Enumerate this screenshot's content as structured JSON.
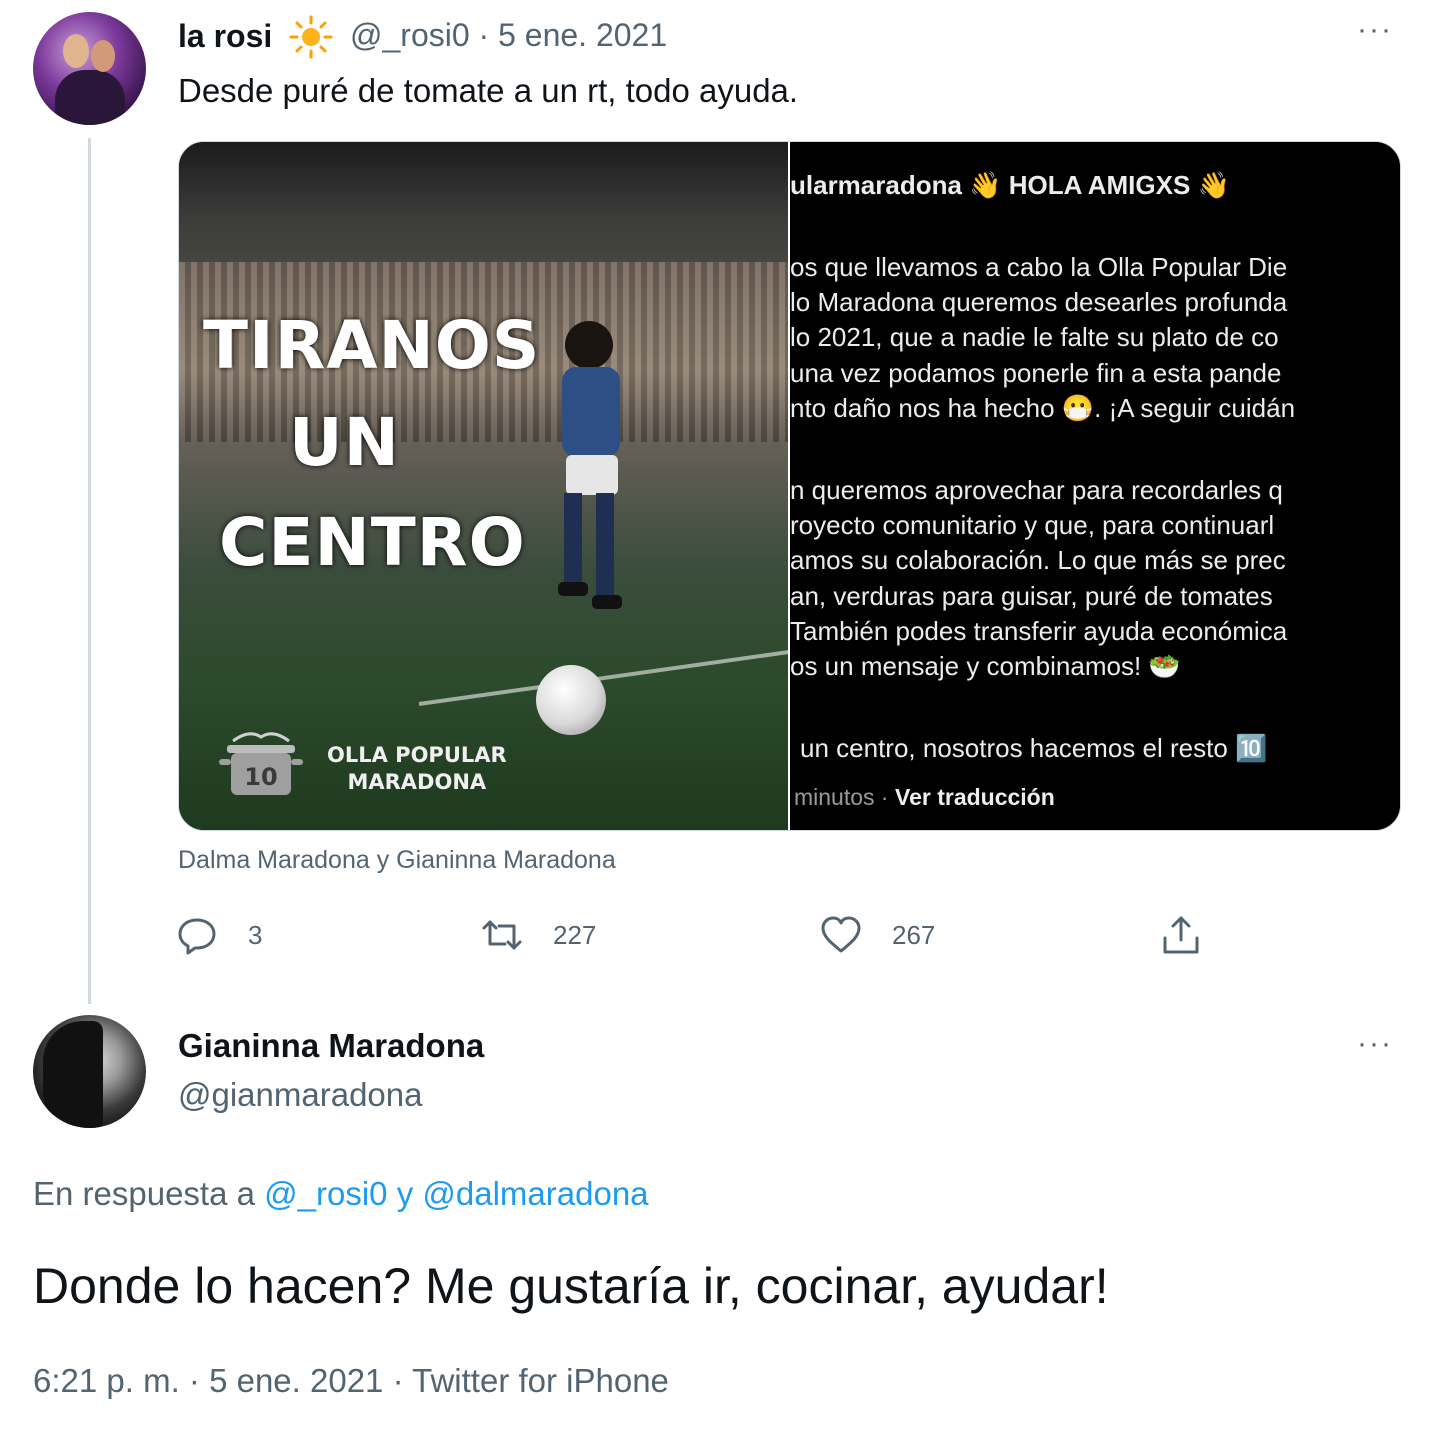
{
  "tweet1": {
    "display_name": "la rosi",
    "name_emoji": "sun-icon",
    "handle_date": "@_rosi0 · 5 ene. 2021",
    "text": "Desde puré de tomate a un rt, todo ayuda.",
    "more": "···",
    "media": {
      "left_text": [
        "TIRANOS",
        "UN",
        "CENTRO"
      ],
      "logo_text_line1": "OLLA POPULAR",
      "logo_text_line2": "MARADONA",
      "logo_number": "10",
      "right_header": "ularmaradona 👋 HOLA AMIGXS 👋",
      "right_lines": [
        "os que llevamos a cabo la Olla Popular Die",
        "lo Maradona queremos desearles profunda",
        "lo 2021, que a nadie le falte su plato de co",
        "una vez podamos ponerle fin a esta pande",
        "nto daño nos ha hecho 😷. ¡A seguir cuidán",
        "n queremos aprovechar para recordarles q",
        "royecto comunitario y que, para continuarl",
        "amos su colaboración. Lo que más se prec",
        "an, verduras para guisar, puré de tomates",
        "También podes transferir ayuda económica",
        "os un mensaje y combinamos! 🥗",
        "un centro, nosotros hacemos el resto 🔟"
      ],
      "right_sub_time": "minutos",
      "right_sub_link": "Ver traducción"
    },
    "caption": "Dalma Maradona y Gianinna Maradona",
    "actions": {
      "replies": "3",
      "retweets": "227",
      "likes": "267"
    }
  },
  "tweet2": {
    "display_name": "Gianinna Maradona",
    "handle": "@gianmaradona",
    "more": "···",
    "reply_prefix": "En respuesta a",
    "reply_to_1": "@_rosi0",
    "reply_joiner": "y",
    "reply_to_2": "@dalmaradona",
    "text": "Donde lo hacen? Me gustaría ir, cocinar, ayudar!",
    "meta": "6:21 p. m. · 5 ene. 2021 · Twitter for iPhone"
  }
}
